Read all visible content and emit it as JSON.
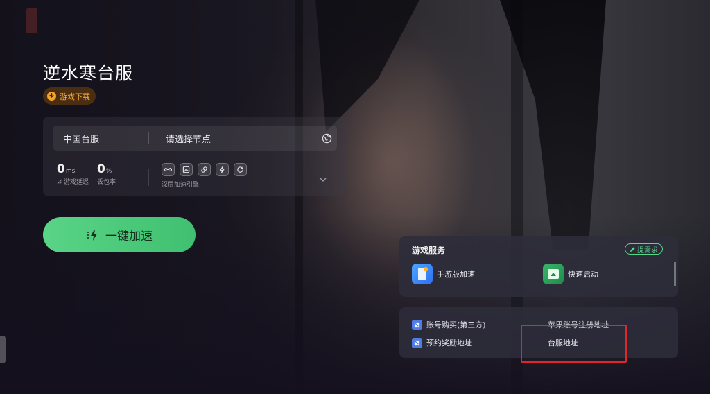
{
  "game": {
    "title": "逆水寒台服",
    "download_label": "游戏下载"
  },
  "server": {
    "region": "中国台服",
    "node_placeholder": "请选择节点"
  },
  "stats": {
    "latency_value": "0",
    "latency_unit": "ms",
    "latency_label": "游戏延迟",
    "loss_value": "0",
    "loss_unit": "%",
    "loss_label": "丢包率",
    "engine_label": "深层加速引擎",
    "engine_icons": [
      "link-icon",
      "image-icon",
      "chain-icon",
      "bolt-icon",
      "refresh-icon"
    ]
  },
  "boost": {
    "label": "一键加速"
  },
  "services": {
    "title": "游戏服务",
    "request_label": "提需求",
    "items": [
      {
        "label": "手游版加速",
        "icon": "mobile-icon"
      },
      {
        "label": "快速启动",
        "icon": "quick-launch-icon"
      }
    ]
  },
  "links": [
    {
      "label": "账号购买(第三方)"
    },
    {
      "label": "预约奖励地址"
    },
    {
      "label": "苹果账号注册地址"
    },
    {
      "label": "台服地址"
    }
  ],
  "colors": {
    "accent_green": "#4ccb7a",
    "download_orange": "#f3a42d",
    "highlight_red": "#e0262a"
  }
}
